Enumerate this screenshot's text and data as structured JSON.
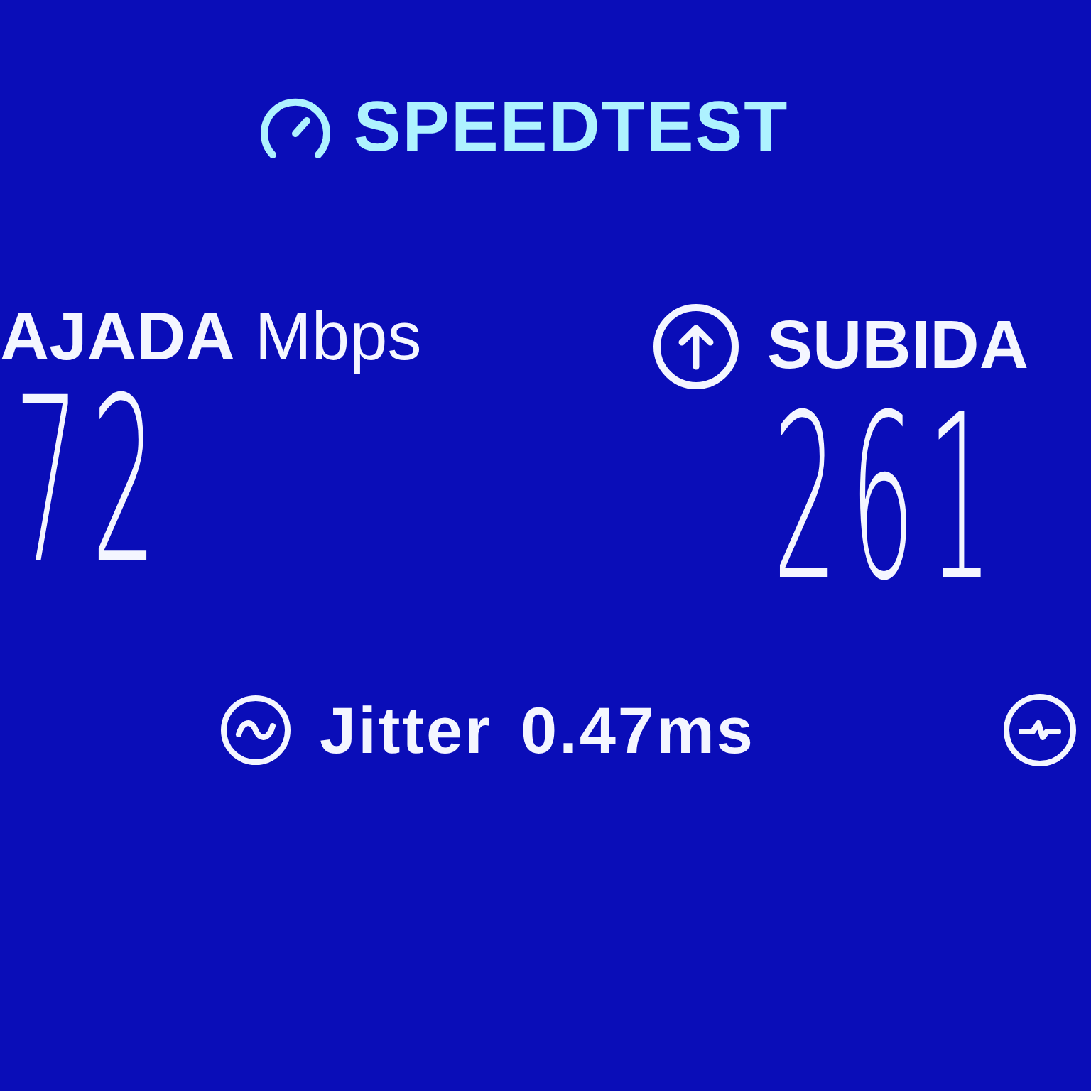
{
  "logo": {
    "text": "SPEEDTEST"
  },
  "results": [
    {
      "kind": "download",
      "label": "AJADA",
      "unit": "Mbps",
      "value": "72"
    },
    {
      "kind": "upload",
      "label": "SUBIDA",
      "value": "261"
    }
  ],
  "metrics": [
    {
      "kind": "jitter",
      "label": "Jitter",
      "value": "0.47ms"
    },
    {
      "kind": "ping"
    }
  ]
}
